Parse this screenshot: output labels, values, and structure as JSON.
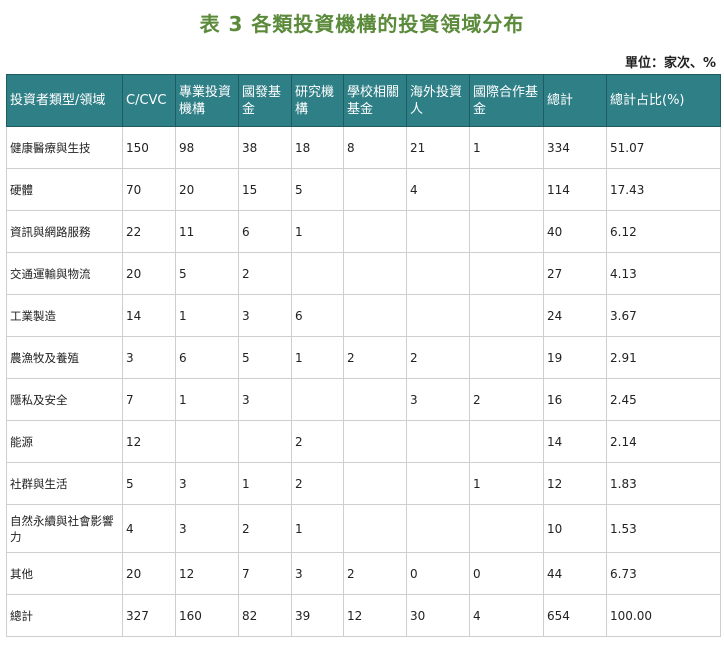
{
  "title": "表 3  各類投資機構的投資領域分布",
  "unit": "單位：家次、%",
  "headers": [
    "投資者類型/領域",
    "C/CVC",
    "專業投資機構",
    "國發基金",
    "研究機構",
    "學校相關基金",
    "海外投資人",
    "國際合作基金",
    "總計",
    "總計占比(%)"
  ],
  "rows": [
    [
      "健康醫療與生技",
      "150",
      "98",
      "38",
      "18",
      "8",
      "21",
      "1",
      "334",
      "51.07"
    ],
    [
      "硬體",
      "70",
      "20",
      "15",
      "5",
      "",
      "4",
      "",
      "114",
      "17.43"
    ],
    [
      "資訊與網路服務",
      "22",
      "11",
      "6",
      "1",
      "",
      "",
      "",
      "40",
      "6.12"
    ],
    [
      "交通運輸與物流",
      "20",
      "5",
      "2",
      "",
      "",
      "",
      "",
      "27",
      "4.13"
    ],
    [
      "工業製造",
      "14",
      "1",
      "3",
      "6",
      "",
      "",
      "",
      "24",
      "3.67"
    ],
    [
      "農漁牧及養殖",
      "3",
      "6",
      "5",
      "1",
      "2",
      "2",
      "",
      "19",
      "2.91"
    ],
    [
      "隱私及安全",
      "7",
      "1",
      "3",
      "",
      "",
      "3",
      "2",
      "16",
      "2.45"
    ],
    [
      "能源",
      "12",
      "",
      "",
      "2",
      "",
      "",
      "",
      "14",
      "2.14"
    ],
    [
      "社群與生活",
      "5",
      "3",
      "1",
      "2",
      "",
      "",
      "1",
      "12",
      "1.83"
    ],
    [
      "自然永續與社會影響力",
      "4",
      "3",
      "2",
      "1",
      "",
      "",
      "",
      "10",
      "1.53"
    ],
    [
      "其他",
      "20",
      "12",
      "7",
      "3",
      "2",
      "0",
      "0",
      "44",
      "6.73"
    ],
    [
      "總計",
      "327",
      "160",
      "82",
      "39",
      "12",
      "30",
      "4",
      "654",
      "100.00"
    ]
  ]
}
